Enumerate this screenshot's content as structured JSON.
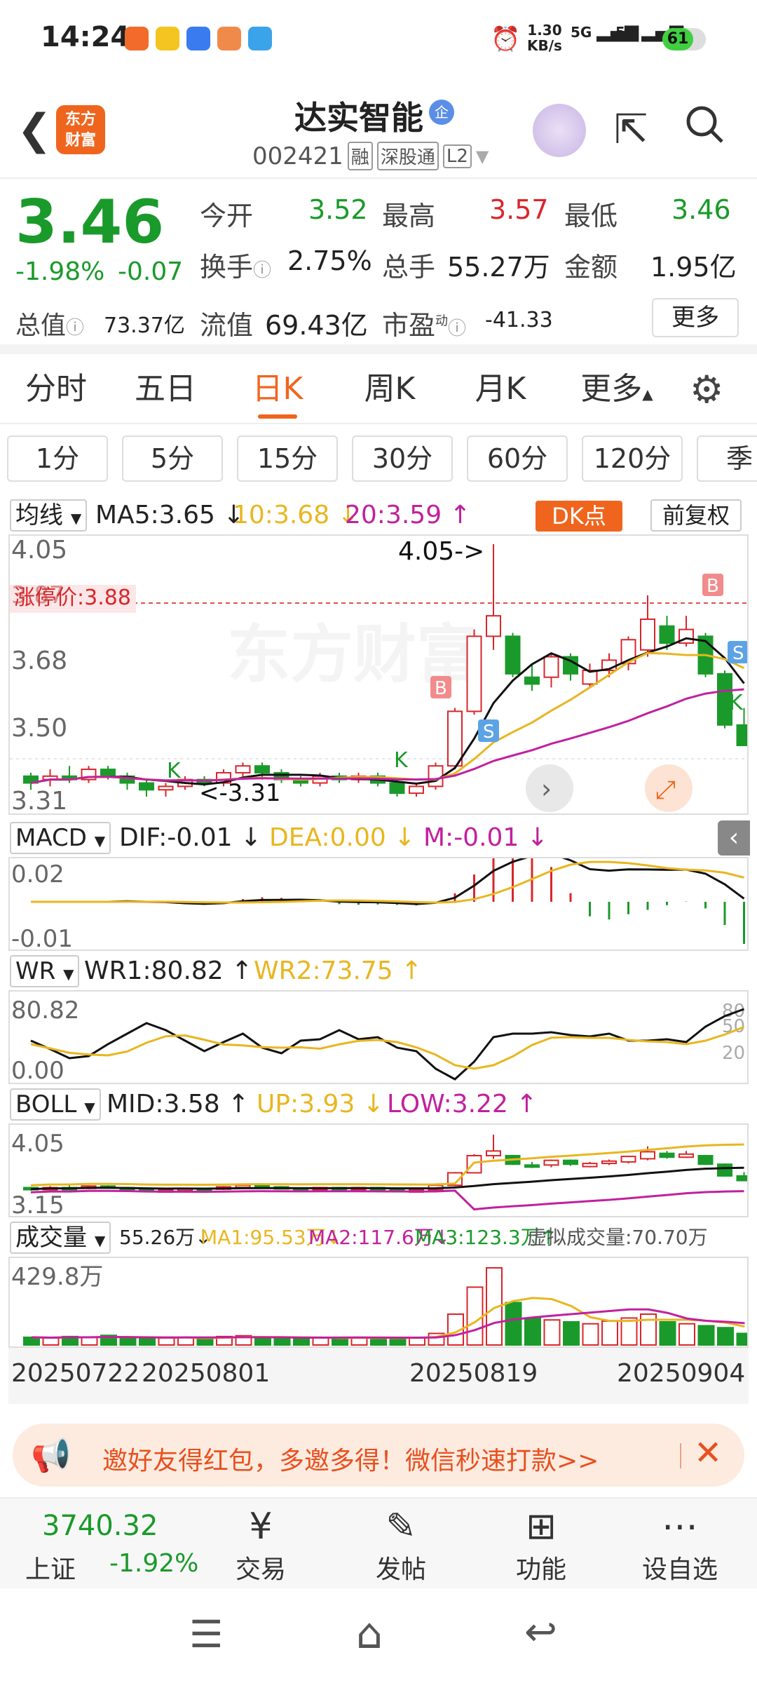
{
  "status": {
    "time": "14:24",
    "net_speed": "1.30",
    "net_unit": "KB/s",
    "sig1": "5G",
    "sig2": "5G",
    "battery": "61"
  },
  "nav": {
    "title": "达实智能",
    "code": "002421",
    "tag1": "融",
    "tag2": "深股通",
    "tag3": "L2",
    "logo_line1": "东方",
    "logo_line2": "财富",
    "title_badge": "企"
  },
  "quote": {
    "price": "3.46",
    "pct": "-1.98%",
    "chg": "-0.07",
    "open_label": "今开",
    "open": "3.52",
    "high_label": "最高",
    "high": "3.57",
    "low_label": "最低",
    "low": "3.46",
    "turnover_label": "换手",
    "turnover": "2.75%",
    "vol_label": "总手",
    "vol": "55.27万",
    "amt_label": "金额",
    "amt": "1.95亿",
    "mcap_label": "总值",
    "mcap": "73.37亿",
    "float_label": "流值",
    "float": "69.43亿",
    "pe_label": "市盈",
    "pe_sup": "动",
    "pe": "-41.33",
    "more": "更多"
  },
  "tabs": [
    "分时",
    "五日",
    "日K",
    "周K",
    "月K",
    "更多"
  ],
  "periods": [
    "1分",
    "5分",
    "15分",
    "30分",
    "60分",
    "120分",
    "季"
  ],
  "kline": {
    "ma_label": "均线",
    "ma5": "MA5:3.65 ↓",
    "ma10": "10:3.68 ↓",
    "ma20": "20:3.59 ↑",
    "dk": "DK点",
    "fq": "前复权",
    "y1": "4.05",
    "y2": "3.87",
    "y3": "3.68",
    "y4": "3.50",
    "y5": "3.31",
    "limit": "涨停价:3.88",
    "hi_note": "4.05->",
    "lo_note": "<-3.31",
    "watermark": "东方财富"
  },
  "macd": {
    "label": "MACD",
    "dif": "DIF:-0.01 ↓",
    "dea": "DEA:0.00 ↓",
    "m": "M:-0.01 ↓",
    "y1": "0.02",
    "y2": "-0.01"
  },
  "wr": {
    "label": "WR",
    "wr1": "WR1:80.82 ↑",
    "wr2": "WR2:73.75 ↑",
    "y1": "80.82",
    "y2": "0.00",
    "r1": "80",
    "r2": "50",
    "r3": "20"
  },
  "boll": {
    "label": "BOLL",
    "mid": "MID:3.58 ↑",
    "up": "UP:3.93 ↓",
    "low": "LOW:3.22 ↑",
    "y1": "4.05",
    "y2": "3.15"
  },
  "volume": {
    "label": "成交量",
    "v": "55.26万↓",
    "ma1": "MA1:95.53万↓",
    "ma2": "MA2:117.6万↓",
    "ma3": "MA3:123.3万↑",
    "virt": "虚拟成交量:70.70万",
    "y1": "429.8万"
  },
  "dates": [
    "20250722",
    "20250801",
    "20250819",
    "20250904"
  ],
  "ad": {
    "text": "邀好友得红包，多邀多得！微信秒速打款>>"
  },
  "bottom": {
    "index_value": "3740.32",
    "index_name": "上证",
    "index_pct": "-1.92%",
    "trade": "交易",
    "post": "发帖",
    "func": "功能",
    "watch": "设自选"
  },
  "colors": {
    "up": "#d9262b",
    "down": "#1a9a2a",
    "accent": "#f0651e",
    "ma10": "#e8b620",
    "ma20": "#c0219e"
  }
}
